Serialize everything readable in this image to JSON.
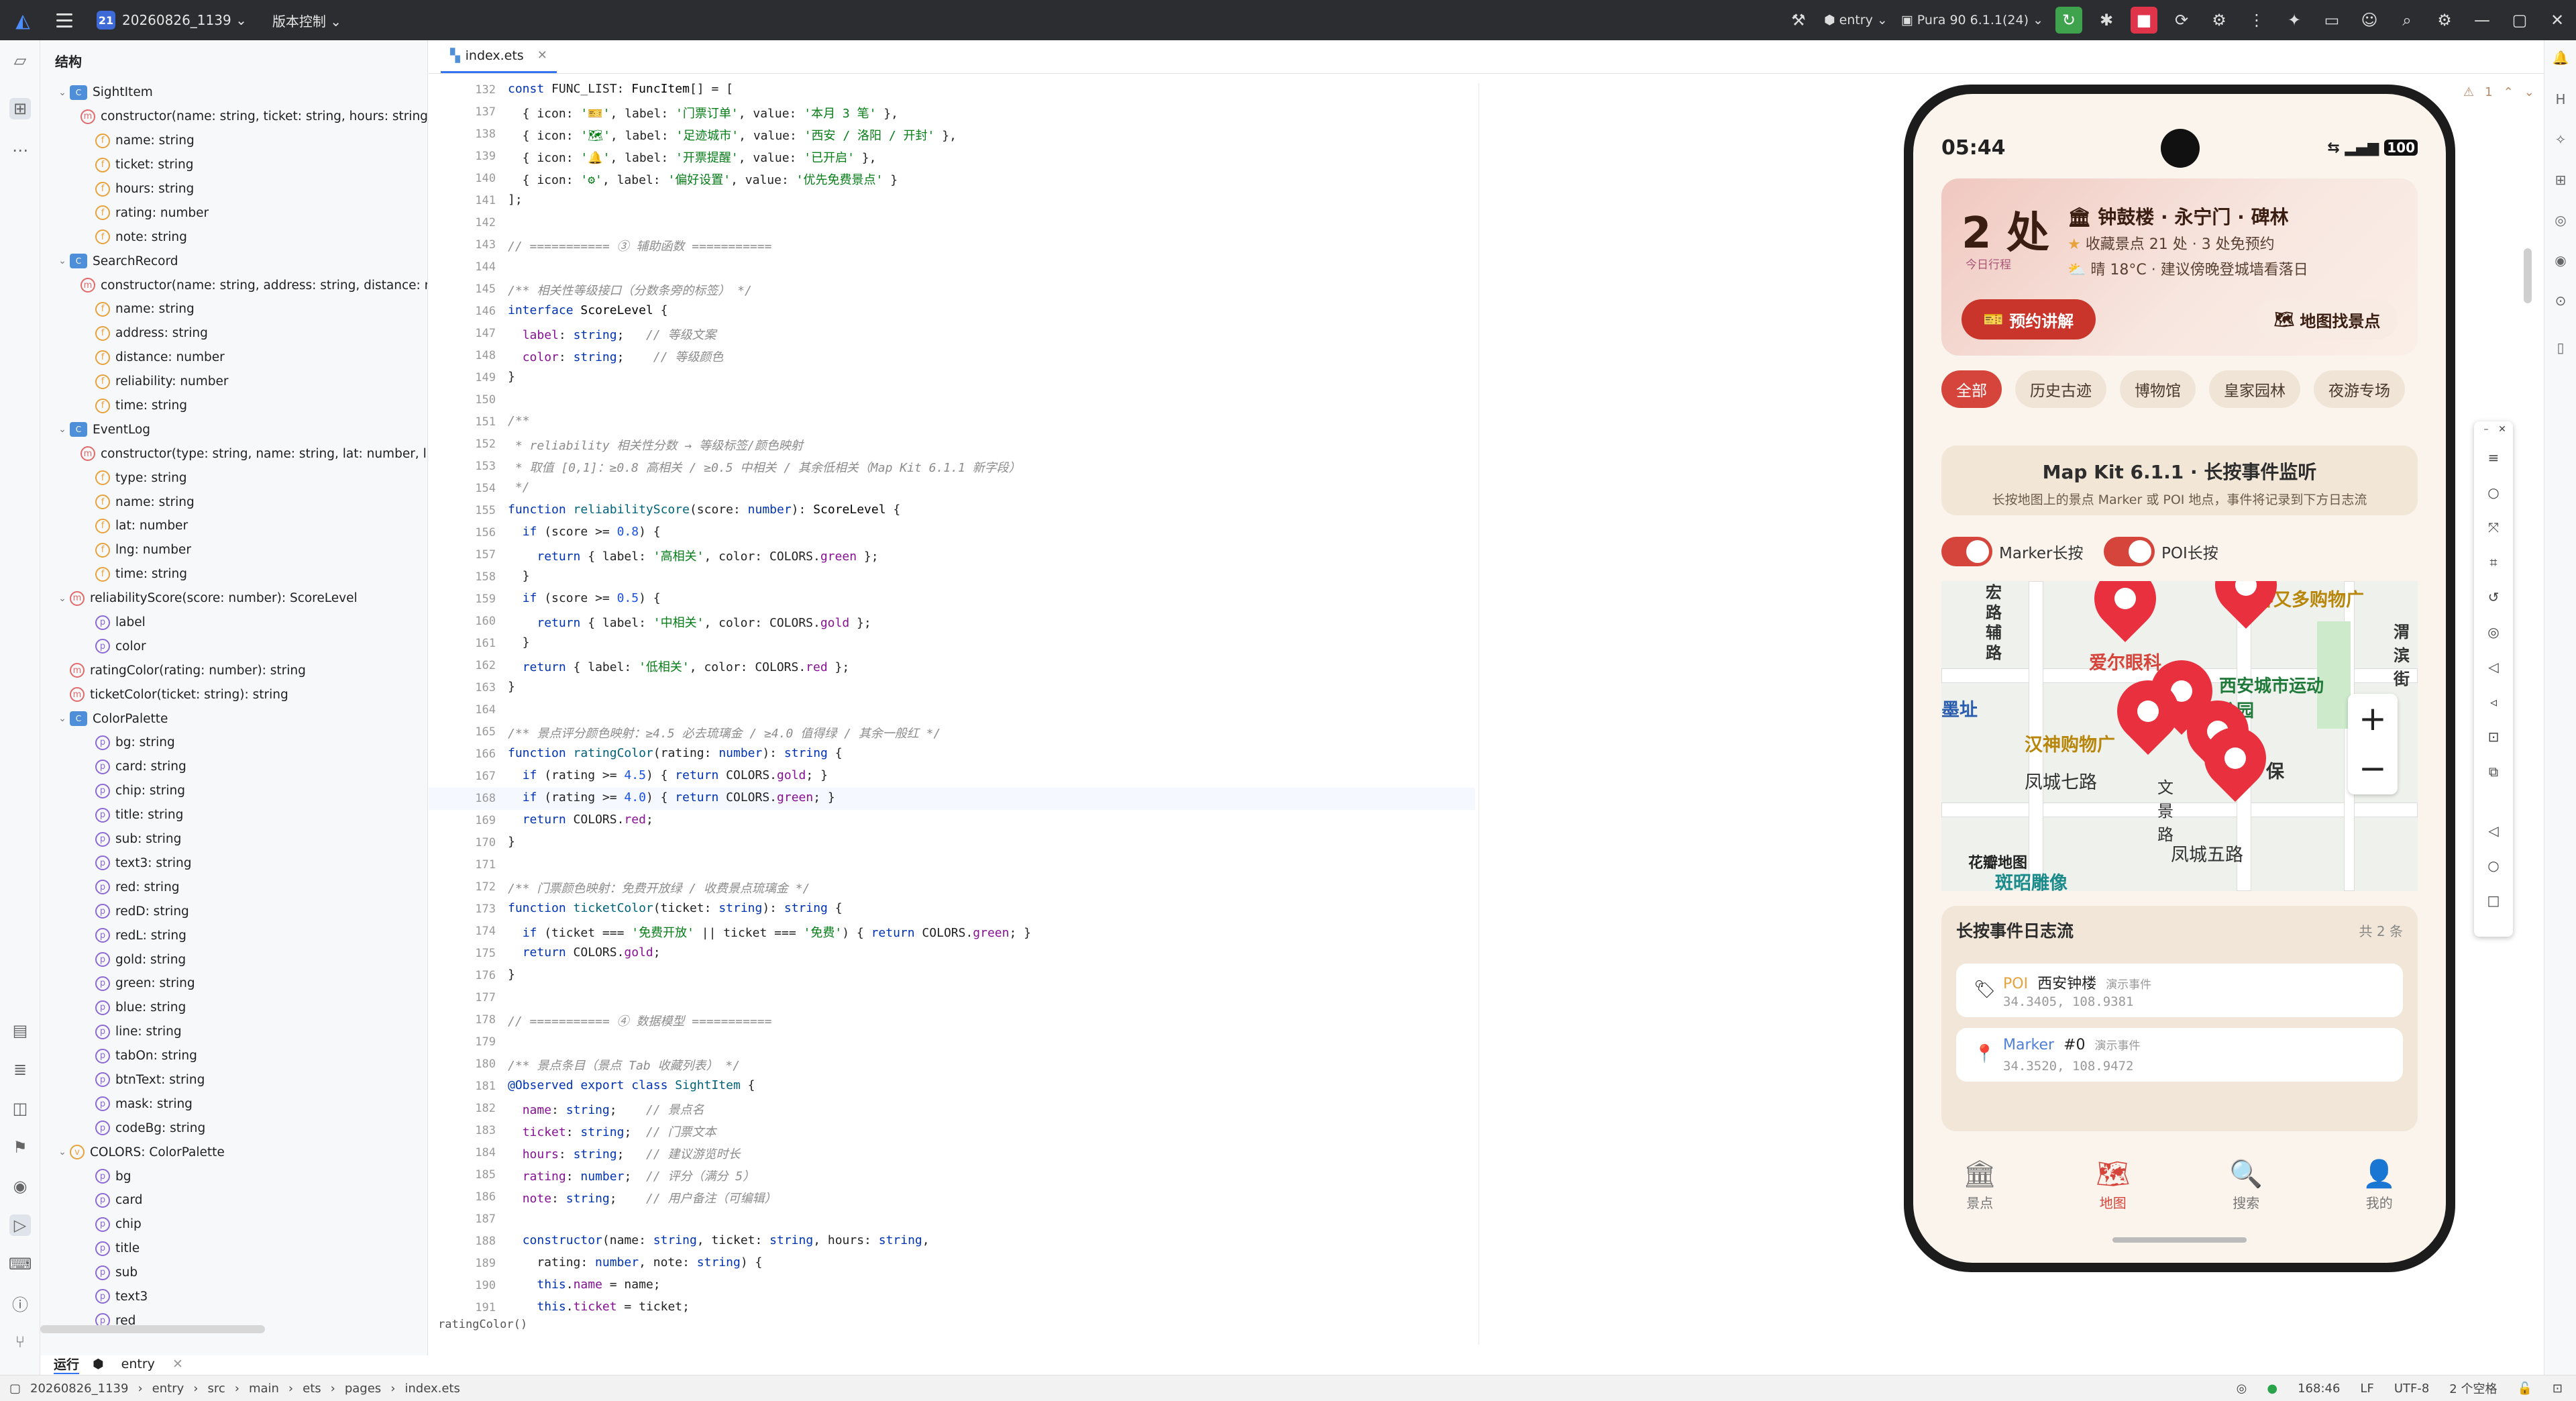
{
  "titlebar": {
    "project_badge": "21",
    "project_name": "20260826_1139",
    "vcs": "版本控制",
    "module": "entry",
    "device": "Pura 90 6.1.1(24)"
  },
  "structure": {
    "title": "结构",
    "items": [
      {
        "depth": 1,
        "arrow": "v",
        "icon": "class",
        "text": "SightItem"
      },
      {
        "depth": 2,
        "arrow": "",
        "icon": "m",
        "text": "constructor(name: string, ticket: string, hours: string, ..."
      },
      {
        "depth": 2,
        "arrow": "",
        "icon": "f",
        "text": "name: string"
      },
      {
        "depth": 2,
        "arrow": "",
        "icon": "f",
        "text": "ticket: string"
      },
      {
        "depth": 2,
        "arrow": "",
        "icon": "f",
        "text": "hours: string"
      },
      {
        "depth": 2,
        "arrow": "",
        "icon": "f",
        "text": "rating: number"
      },
      {
        "depth": 2,
        "arrow": "",
        "icon": "f",
        "text": "note: string"
      },
      {
        "depth": 1,
        "arrow": "v",
        "icon": "class",
        "text": "SearchRecord"
      },
      {
        "depth": 2,
        "arrow": "",
        "icon": "m",
        "text": "constructor(name: string, address: string, distance: n..."
      },
      {
        "depth": 2,
        "arrow": "",
        "icon": "f",
        "text": "name: string"
      },
      {
        "depth": 2,
        "arrow": "",
        "icon": "f",
        "text": "address: string"
      },
      {
        "depth": 2,
        "arrow": "",
        "icon": "f",
        "text": "distance: number"
      },
      {
        "depth": 2,
        "arrow": "",
        "icon": "f",
        "text": "reliability: number"
      },
      {
        "depth": 2,
        "arrow": "",
        "icon": "f",
        "text": "time: string"
      },
      {
        "depth": 1,
        "arrow": "v",
        "icon": "class",
        "text": "EventLog"
      },
      {
        "depth": 2,
        "arrow": "",
        "icon": "m",
        "text": "constructor(type: string, name: string, lat: number, l..."
      },
      {
        "depth": 2,
        "arrow": "",
        "icon": "f",
        "text": "type: string"
      },
      {
        "depth": 2,
        "arrow": "",
        "icon": "f",
        "text": "name: string"
      },
      {
        "depth": 2,
        "arrow": "",
        "icon": "f",
        "text": "lat: number"
      },
      {
        "depth": 2,
        "arrow": "",
        "icon": "f",
        "text": "lng: number"
      },
      {
        "depth": 2,
        "arrow": "",
        "icon": "f",
        "text": "time: string"
      },
      {
        "depth": 1,
        "arrow": "v",
        "icon": "m",
        "text": "reliabilityScore(score: number): ScoreLevel"
      },
      {
        "depth": 2,
        "arrow": "",
        "icon": "p",
        "text": "label"
      },
      {
        "depth": 2,
        "arrow": "",
        "icon": "p",
        "text": "color"
      },
      {
        "depth": 1,
        "arrow": "",
        "icon": "m",
        "text": "ratingColor(rating: number): string"
      },
      {
        "depth": 1,
        "arrow": "",
        "icon": "m",
        "text": "ticketColor(ticket: string): string"
      },
      {
        "depth": 1,
        "arrow": "v",
        "icon": "class",
        "text": "ColorPalette"
      },
      {
        "depth": 2,
        "arrow": "",
        "icon": "p",
        "text": "bg: string"
      },
      {
        "depth": 2,
        "arrow": "",
        "icon": "p",
        "text": "card: string"
      },
      {
        "depth": 2,
        "arrow": "",
        "icon": "p",
        "text": "chip: string"
      },
      {
        "depth": 2,
        "arrow": "",
        "icon": "p",
        "text": "title: string"
      },
      {
        "depth": 2,
        "arrow": "",
        "icon": "p",
        "text": "sub: string"
      },
      {
        "depth": 2,
        "arrow": "",
        "icon": "p",
        "text": "text3: string"
      },
      {
        "depth": 2,
        "arrow": "",
        "icon": "p",
        "text": "red: string"
      },
      {
        "depth": 2,
        "arrow": "",
        "icon": "p",
        "text": "redD: string"
      },
      {
        "depth": 2,
        "arrow": "",
        "icon": "p",
        "text": "redL: string"
      },
      {
        "depth": 2,
        "arrow": "",
        "icon": "p",
        "text": "gold: string"
      },
      {
        "depth": 2,
        "arrow": "",
        "icon": "p",
        "text": "green: string"
      },
      {
        "depth": 2,
        "arrow": "",
        "icon": "p",
        "text": "blue: string"
      },
      {
        "depth": 2,
        "arrow": "",
        "icon": "p",
        "text": "line: string"
      },
      {
        "depth": 2,
        "arrow": "",
        "icon": "p",
        "text": "tabOn: string"
      },
      {
        "depth": 2,
        "arrow": "",
        "icon": "p",
        "text": "btnText: string"
      },
      {
        "depth": 2,
        "arrow": "",
        "icon": "p",
        "text": "mask: string"
      },
      {
        "depth": 2,
        "arrow": "",
        "icon": "p",
        "text": "codeBg: string"
      },
      {
        "depth": 1,
        "arrow": "v",
        "icon": "v",
        "text": "COLORS: ColorPalette"
      },
      {
        "depth": 2,
        "arrow": "",
        "icon": "p",
        "text": "bg"
      },
      {
        "depth": 2,
        "arrow": "",
        "icon": "p",
        "text": "card"
      },
      {
        "depth": 2,
        "arrow": "",
        "icon": "p",
        "text": "chip"
      },
      {
        "depth": 2,
        "arrow": "",
        "icon": "p",
        "text": "title"
      },
      {
        "depth": 2,
        "arrow": "",
        "icon": "p",
        "text": "sub"
      },
      {
        "depth": 2,
        "arrow": "",
        "icon": "p",
        "text": "text3"
      },
      {
        "depth": 2,
        "arrow": "",
        "icon": "p",
        "text": "red"
      }
    ]
  },
  "editor": {
    "tab": "index.ets",
    "breadcrumb": "ratingColor()",
    "lines": [
      {
        "n": "132",
        "h": "<span class='kw'>const</span> FUNC_LIST: <span class='ty'>FuncItem</span>[] = ["
      },
      {
        "n": "137",
        "h": "  { icon: <span class='str'>'🎫'</span>, label: <span class='str'>'门票订单'</span>, value: <span class='str'>'本月 3 笔'</span> },"
      },
      {
        "n": "138",
        "h": "  { icon: <span class='str'>'🗺'</span>, label: <span class='str'>'足迹城市'</span>, value: <span class='str'>'西安 / 洛阳 / 开封'</span> },"
      },
      {
        "n": "139",
        "h": "  { icon: <span class='str'>'🔔'</span>, label: <span class='str'>'开票提醒'</span>, value: <span class='str'>'已开启'</span> },"
      },
      {
        "n": "140",
        "h": "  { icon: <span class='str'>'⚙'</span>, label: <span class='str'>'偏好设置'</span>, value: <span class='str'>'优先免费景点'</span> }"
      },
      {
        "n": "141",
        "h": "];"
      },
      {
        "n": "142",
        "h": ""
      },
      {
        "n": "143",
        "h": "<span class='cm'>// =========== ③ 辅助函数 ===========</span>"
      },
      {
        "n": "144",
        "h": ""
      },
      {
        "n": "145",
        "h": "<span class='cm'>/** 相关性等级接口（分数条旁的标签） */</span>"
      },
      {
        "n": "146",
        "h": "<span class='kw'>interface</span> <span class='ty'>ScoreLevel</span> {"
      },
      {
        "n": "147",
        "h": "  <span class='prop'>label</span>: <span class='kw'>string</span>;   <span class='cm'>// 等级文案</span>"
      },
      {
        "n": "148",
        "h": "  <span class='prop'>color</span>: <span class='kw'>string</span>;    <span class='cm'>// 等级颜色</span>"
      },
      {
        "n": "149",
        "h": "}"
      },
      {
        "n": "150",
        "h": ""
      },
      {
        "n": "151",
        "h": "<span class='cm'>/**</span>"
      },
      {
        "n": "152",
        "h": "<span class='cm'> * reliability 相关性分数 → 等级标签/颜色映射</span>"
      },
      {
        "n": "153",
        "h": "<span class='cm'> * 取值 [0,1]：≥0.8 高相关 / ≥0.5 中相关 / 其余低相关（Map Kit 6.1.1 新字段）</span>"
      },
      {
        "n": "154",
        "h": "<span class='cm'> */</span>"
      },
      {
        "n": "155",
        "h": "<span class='kw'>function</span> <span class='fn'>reliabilityScore</span>(score: <span class='kw'>number</span>): <span class='ty'>ScoreLevel</span> {"
      },
      {
        "n": "156",
        "h": "  <span class='kw'>if</span> (score >= <span class='num'>0.8</span>) {"
      },
      {
        "n": "157",
        "h": "    <span class='kw'>return</span> { label: <span class='str'>'高相关'</span>, color: COLORS.<span class='prop'>green</span> };"
      },
      {
        "n": "158",
        "h": "  }"
      },
      {
        "n": "159",
        "h": "  <span class='kw'>if</span> (score >= <span class='num'>0.5</span>) {"
      },
      {
        "n": "160",
        "h": "    <span class='kw'>return</span> { label: <span class='str'>'中相关'</span>, color: COLORS.<span class='prop'>gold</span> };"
      },
      {
        "n": "161",
        "h": "  }"
      },
      {
        "n": "162",
        "h": "  <span class='kw'>return</span> { label: <span class='str'>'低相关'</span>, color: COLORS.<span class='prop'>red</span> };"
      },
      {
        "n": "163",
        "h": "}"
      },
      {
        "n": "164",
        "h": ""
      },
      {
        "n": "165",
        "h": "<span class='cm'>/** 景点评分颜色映射：≥4.5 必去琉璃金 / ≥4.0 值得绿 / 其余一般红 */</span>"
      },
      {
        "n": "166",
        "h": "<span class='kw'>function</span> <span class='fn'>ratingColor</span>(rating: <span class='kw'>number</span>): <span class='kw'>string</span> {"
      },
      {
        "n": "167",
        "h": "  <span class='kw'>if</span> (rating >= <span class='num'>4.5</span>) { <span class='kw'>return</span> COLORS.<span class='prop'>gold</span>; }"
      },
      {
        "n": "168",
        "h": "  <span class='kw'>if</span> (rating >= <span class='num'>4.0</span>) { <span class='kw'>return</span> COLORS.<span class='prop'>green</span>; }"
      },
      {
        "n": "169",
        "h": "  <span class='kw'>return</span> COLORS.<span class='prop'>red</span>;"
      },
      {
        "n": "170",
        "h": "}"
      },
      {
        "n": "171",
        "h": ""
      },
      {
        "n": "172",
        "h": "<span class='cm'>/** 门票颜色映射：免费开放绿 / 收费景点琉璃金 */</span>"
      },
      {
        "n": "173",
        "h": "<span class='kw'>function</span> <span class='fn'>ticketColor</span>(ticket: <span class='kw'>string</span>): <span class='kw'>string</span> {"
      },
      {
        "n": "174",
        "h": "  <span class='kw'>if</span> (ticket === <span class='str'>'免费开放'</span> || ticket === <span class='str'>'免费'</span>) { <span class='kw'>return</span> COLORS.<span class='prop'>green</span>; }"
      },
      {
        "n": "175",
        "h": "  <span class='kw'>return</span> COLORS.<span class='prop'>gold</span>;"
      },
      {
        "n": "176",
        "h": "}"
      },
      {
        "n": "177",
        "h": ""
      },
      {
        "n": "178",
        "h": "<span class='cm'>// =========== ④ 数据模型 ===========</span>"
      },
      {
        "n": "179",
        "h": ""
      },
      {
        "n": "180",
        "h": "<span class='cm'>/** 景点条目（景点 Tab 收藏列表） */</span>"
      },
      {
        "n": "181",
        "h": "<span class='kw'>@Observed export class</span> <span class='fn'>SightItem</span> {"
      },
      {
        "n": "182",
        "h": "  <span class='prop'>name</span>: <span class='kw'>string</span>;    <span class='cm'>// 景点名</span>"
      },
      {
        "n": "183",
        "h": "  <span class='prop'>ticket</span>: <span class='kw'>string</span>;  <span class='cm'>// 门票文本</span>"
      },
      {
        "n": "184",
        "h": "  <span class='prop'>hours</span>: <span class='kw'>string</span>;   <span class='cm'>// 建议游览时长</span>"
      },
      {
        "n": "185",
        "h": "  <span class='prop'>rating</span>: <span class='kw'>number</span>;  <span class='cm'>// 评分（满分 5）</span>"
      },
      {
        "n": "186",
        "h": "  <span class='prop'>note</span>: <span class='kw'>string</span>;    <span class='cm'>// 用户备注（可编辑）</span>"
      },
      {
        "n": "187",
        "h": ""
      },
      {
        "n": "188",
        "h": "  <span class='kw'>constructor</span>(name: <span class='kw'>string</span>, ticket: <span class='kw'>string</span>, hours: <span class='kw'>string</span>,"
      },
      {
        "n": "189",
        "h": "    rating: <span class='kw'>number</span>, note: <span class='kw'>string</span>) {"
      },
      {
        "n": "190",
        "h": "    <span class='kw'>this</span>.<span class='prop'>name</span> = name;"
      },
      {
        "n": "191",
        "h": "    <span class='kw'>this</span>.<span class='prop'>ticket</span> = ticket;"
      }
    ]
  },
  "runbar": {
    "run": "运行",
    "entry": "entry"
  },
  "status": {
    "path": [
      "20260826_1139",
      "entry",
      "src",
      "main",
      "ets",
      "pages",
      "index.ets"
    ],
    "pos": "168:46",
    "lf": "LF",
    "enc": "UTF-8",
    "indent": "2 个空格"
  },
  "warning": "1",
  "phone": {
    "time": "05:44",
    "battery": "100",
    "hero": {
      "big": "2 处",
      "small": "今日行程",
      "line1": "钟鼓楼 · 永宁门 · 碑林",
      "line2": "收藏景点 21 处 · 3 处免预约",
      "line3": "晴 18°C · 建议傍晚登城墙看落日",
      "btn_book": "预约讲解",
      "btn_map": "地图找景点"
    },
    "chips": [
      "全部",
      "历史古迹",
      "博物馆",
      "皇家园林",
      "夜游专场"
    ],
    "mk": {
      "title": "Map Kit 6.1.1 · 长按事件监听",
      "sub": "长按地图上的景点 Marker 或 POI 地点，事件将记录到下方日志流"
    },
    "toggles": [
      "Marker长按",
      "POI长按"
    ],
    "map_labels": [
      "宏路辅路",
      "客又多购物广",
      "爱尔眼科",
      "西安城市运动公园",
      "渭滨街",
      "汉神购物广",
      "凤城七路",
      "文景路",
      "凤城五路",
      "花瓣地图",
      "斑昭雕像",
      "墨址",
      "保"
    ],
    "log": {
      "title": "长按事件日志流",
      "count": "共 2 条",
      "items": [
        {
          "type": "POI",
          "name": "西安钟楼",
          "tag": "演示事件",
          "coord": "34.3405, 108.9381"
        },
        {
          "type": "Marker",
          "name": "#0",
          "tag": "演示事件",
          "coord": "34.3520, 108.9472"
        }
      ]
    },
    "nav": [
      "景点",
      "地图",
      "搜索",
      "我的"
    ]
  },
  "colors": {
    "accent": "#d6453b",
    "ide_blue": "#3574f0",
    "run_green": "#3fa34d"
  }
}
